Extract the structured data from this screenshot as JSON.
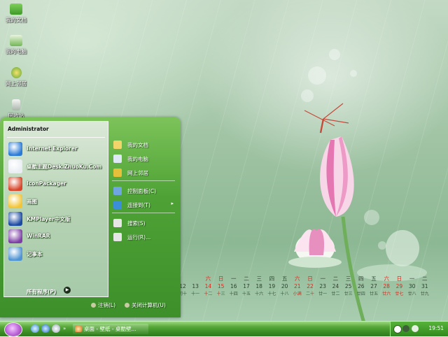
{
  "desktop": {
    "icons": [
      {
        "label": "我的文档",
        "icon": "folder-icon"
      },
      {
        "label": "我的电脑",
        "icon": "computer-icon"
      },
      {
        "label": "网上邻居",
        "icon": "network-icon"
      },
      {
        "label": "回收站",
        "icon": "recycle-bin-icon"
      }
    ]
  },
  "calendar": {
    "columns": [
      {
        "weekday": "",
        "day": "12",
        "lunar": "初十",
        "red": false
      },
      {
        "weekday": "",
        "day": "13",
        "lunar": "十一",
        "red": false
      },
      {
        "weekday": "六",
        "day": "14",
        "lunar": "十二",
        "red": true
      },
      {
        "weekday": "日",
        "day": "15",
        "lunar": "十三",
        "red": true
      },
      {
        "weekday": "一",
        "day": "16",
        "lunar": "十四",
        "red": false
      },
      {
        "weekday": "二",
        "day": "17",
        "lunar": "十五",
        "red": false
      },
      {
        "weekday": "三",
        "day": "18",
        "lunar": "十六",
        "red": false
      },
      {
        "weekday": "四",
        "day": "19",
        "lunar": "十七",
        "red": false
      },
      {
        "weekday": "五",
        "day": "20",
        "lunar": "十八",
        "red": false
      },
      {
        "weekday": "六",
        "day": "21",
        "lunar": "小满",
        "red": true
      },
      {
        "weekday": "日",
        "day": "22",
        "lunar": "二十",
        "red": true
      },
      {
        "weekday": "一",
        "day": "23",
        "lunar": "廿一",
        "red": false
      },
      {
        "weekday": "二",
        "day": "24",
        "lunar": "廿二",
        "red": false
      },
      {
        "weekday": "三",
        "day": "25",
        "lunar": "廿三",
        "red": false
      },
      {
        "weekday": "四",
        "day": "26",
        "lunar": "廿四",
        "red": false
      },
      {
        "weekday": "五",
        "day": "27",
        "lunar": "廿五",
        "red": false
      },
      {
        "weekday": "六",
        "day": "28",
        "lunar": "廿六",
        "red": true
      },
      {
        "weekday": "日",
        "day": "29",
        "lunar": "廿七",
        "red": true
      },
      {
        "weekday": "一",
        "day": "30",
        "lunar": "廿八",
        "red": false
      },
      {
        "weekday": "二",
        "day": "31",
        "lunar": "廿九",
        "red": false
      }
    ]
  },
  "start_menu": {
    "user": "Administrator",
    "apps": [
      {
        "label": "Internet Explorer",
        "icon": "internet-explorer-icon",
        "color": "#2a7bd6"
      },
      {
        "label": "桌酷主题Desk.ZhuoKu.Com",
        "icon": "zhuoku-theme-icon",
        "color": "#e9edf3"
      },
      {
        "label": "IconPackager",
        "icon": "iconpackager-icon",
        "color": "#d8452a"
      },
      {
        "label": "画图",
        "icon": "paint-icon",
        "color": "#f2c436"
      },
      {
        "label": "KMPlayer中文版",
        "icon": "kmplayer-icon",
        "color": "#1b4aa2"
      },
      {
        "label": "WinRAR",
        "icon": "winrar-icon",
        "color": "#7d3fa5"
      },
      {
        "label": "记事本",
        "icon": "notepad-icon",
        "color": "#4f93d4"
      }
    ],
    "all_programs": "所有程序(P)",
    "places": [
      {
        "label": "我的文档",
        "icon": "documents-folder-icon",
        "color": "#f1d56a",
        "sub": ""
      },
      {
        "label": "我的电脑",
        "icon": "my-computer-icon",
        "color": "#dfe9f5",
        "sub": ""
      },
      {
        "label": "网上邻居",
        "icon": "network-places-icon",
        "color": "#e6c03b",
        "sub": ""
      }
    ],
    "system": [
      {
        "label": "控制面板(C)",
        "icon": "control-panel-icon",
        "color": "#6fa6e0",
        "sub": ""
      },
      {
        "label": "连接到(T)",
        "icon": "connect-to-icon",
        "color": "#3b8fd9",
        "sub": "▸"
      }
    ],
    "tools": [
      {
        "label": "搜索(S)",
        "icon": "search-icon",
        "color": "#e6e6e6",
        "sub": ""
      },
      {
        "label": "运行(R)...",
        "icon": "run-icon",
        "color": "#e6e6e6",
        "sub": ""
      }
    ],
    "logoff": "注销(L)",
    "shutdown": "关闭计算机(U)"
  },
  "taskbar": {
    "tasks": [
      {
        "label": "桌面 - 壁纸 - 桌酷壁...",
        "icon": "browser-window-icon"
      }
    ],
    "clock": "19:51"
  }
}
